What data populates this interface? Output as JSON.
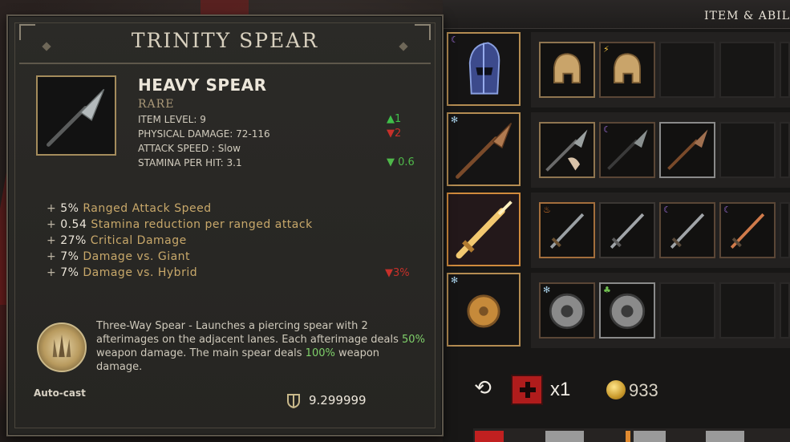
{
  "panel": {
    "title": "ITEM & ABIL"
  },
  "tooltip": {
    "title": "TRINITY SPEAR",
    "item_name": "HEAVY SPEAR",
    "rarity": "RARE",
    "stats": [
      {
        "text": "ITEM LEVEL: 9",
        "delta": "▲1",
        "dir": "up"
      },
      {
        "text": "PHYSICAL DAMAGE: 72-116",
        "delta": "▼2",
        "dir": "down"
      },
      {
        "text": "ATTACK SPEED : Slow",
        "delta": "",
        "dir": ""
      },
      {
        "text": "STAMINA PER HIT: 3.1",
        "delta": "▼ 0.6",
        "dir": "greenval"
      }
    ],
    "bonuses": [
      {
        "plus": "+",
        "num": "5%",
        "label": "Ranged Attack Speed",
        "delta": ""
      },
      {
        "plus": "+",
        "num": "0.54",
        "label": "Stamina reduction per ranged attack",
        "delta": ""
      },
      {
        "plus": "+",
        "num": "27%",
        "label": "Critical Damage",
        "delta": ""
      },
      {
        "plus": "+",
        "num": "7%",
        "label": "Damage vs. Giant",
        "delta": ""
      },
      {
        "plus": "+",
        "num": "7%",
        "label": "Damage vs. Hybrid",
        "delta": "▼3%"
      }
    ],
    "ability": {
      "desc_a": "Three-Way Spear - Launches a piercing spear with 2 afterimages on the adjacent lanes. Each afterimage deals ",
      "pct1": "50%",
      "desc_b": " weapon damage. The main spear deals ",
      "pct2": "100%",
      "desc_c": " weapon damage.",
      "mode": "Auto-cast"
    },
    "weight": "9.299999"
  },
  "rows": [
    {
      "main": "helmet-icon",
      "main_badge": "moon",
      "slots": [
        "helmet-icon",
        "helmet-icon",
        "",
        "",
        ""
      ],
      "badges": [
        "",
        "bolt",
        "",
        "",
        ""
      ]
    },
    {
      "main": "spear-icon",
      "main_badge": "frost",
      "slots": [
        "spear-icon",
        "spear-icon",
        "spear-icon",
        "",
        ""
      ],
      "badges": [
        "",
        "moon",
        "",
        "",
        ""
      ]
    },
    {
      "main": "sword-icon",
      "main_badge": "",
      "slots": [
        "sword-icon",
        "sword-icon",
        "sword-icon",
        "sword-icon",
        ""
      ],
      "badges": [
        "fire",
        "",
        "moon",
        "moon",
        ""
      ]
    },
    {
      "main": "shield-icon",
      "main_badge": "frost",
      "slots": [
        "shield-icon",
        "shield-icon",
        "",
        "",
        ""
      ],
      "badges": [
        "frost",
        "leaf",
        "",
        "",
        ""
      ]
    }
  ],
  "footer": {
    "heal_count": "x1",
    "gold": "933"
  },
  "colors": {
    "rare": "#a99878",
    "up": "#3fbf4a",
    "down": "#c7302a",
    "accent_border": "#b48c52"
  }
}
